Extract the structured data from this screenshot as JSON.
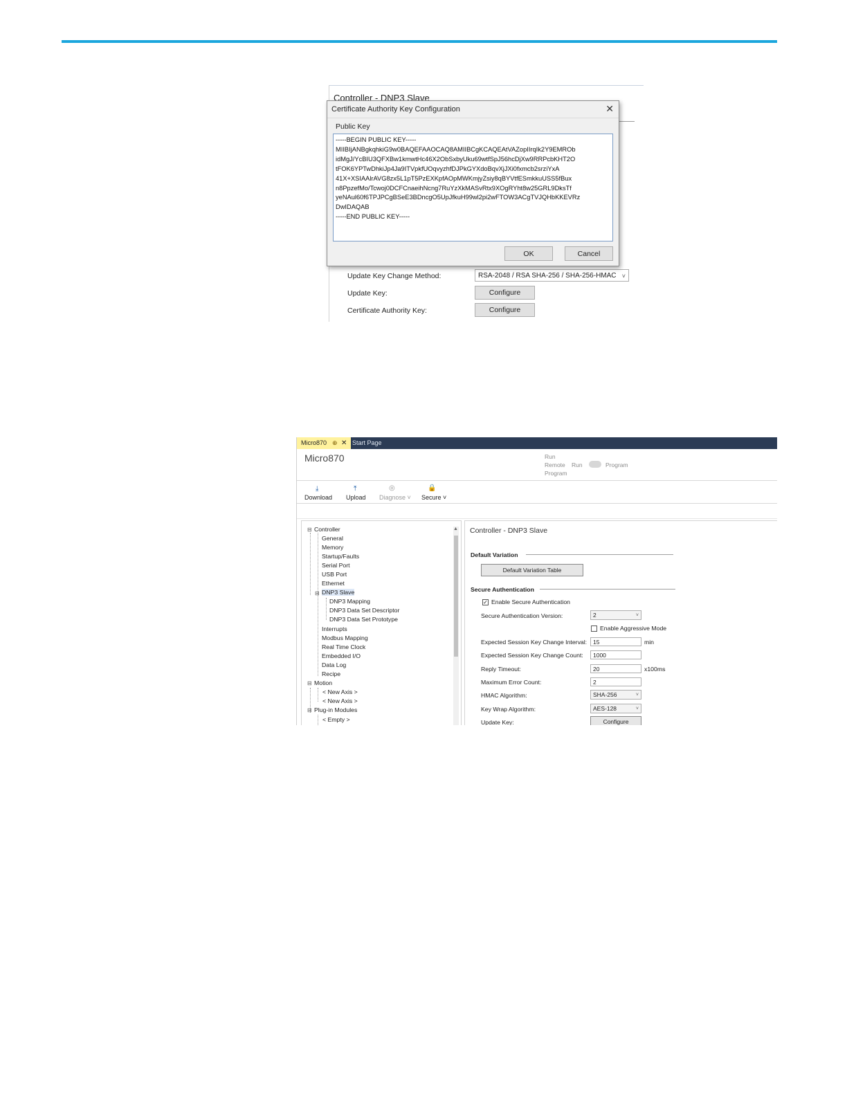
{
  "screenshot1": {
    "background_title": "Controller - DNP3 Slave",
    "update_key_change_method_label": "Update Key Change Method:",
    "update_key_change_method_value": "RSA-2048 / RSA SHA-256 / SHA-256-HMAC",
    "update_key_label": "Update Key:",
    "certificate_authority_key_label": "Certificate Authority Key:",
    "configure_label": "Configure",
    "dialog": {
      "title": "Certificate Authority Key Configuration",
      "public_key_label": "Public Key",
      "key_text": "-----BEGIN PUBLIC KEY-----\nMIIBIjANBgkqhkiG9w0BAQEFAAOCAQ8AMIIBCgKCAQEAtVAZopIIrqIk2Y9EMROb\nidMgJ/YcBIU3QFXBw1kmwtHc46X2ObSxbyUku69wtfSpJ56hcDjXw9RRPcbKHT2O\ntFOK6YPTwDhkiJp4Ja9ITVpkfUOqvyzhfDJPkGYXdoBqvXjJXi0fxmcb2srziYxA\n41X+XSIAAlrAVG8zx5L1pT5PzEXKpfAOpMWKmjyZsiy8qBYVtfESmkkuUSS5fBux\nn8PpzefMo/Tcwoj0DCFCnaeihNcng7RuYzXkMASvRtx9XOgRYht8w25GRL9DksTf\nyeNAul60f6TPJPCgBSeE3BDncgO5UpJfkuH99wl2pi2wFTOW3ACgTVJQHbKKEVRz\nDwIDAQAB\n-----END PUBLIC KEY-----",
      "ok_label": "OK",
      "cancel_label": "Cancel",
      "close_glyph": "✕"
    }
  },
  "screenshot2": {
    "tabs": [
      {
        "label": "Micro870",
        "pin": "⊕",
        "close": "✕"
      },
      {
        "label": "Start Page"
      }
    ],
    "app_title": "Micro870",
    "mode": {
      "run": "Run",
      "remote": "Remote",
      "run2": "Run",
      "program": "Program",
      "program2": "Program"
    },
    "toolbar": [
      {
        "label": "Download",
        "icon": "download-icon"
      },
      {
        "label": "Upload",
        "icon": "upload-icon"
      },
      {
        "label": "Diagnose ˅",
        "icon": "diagnose-icon"
      },
      {
        "label": "Secure ˅",
        "icon": "lock-icon"
      }
    ],
    "tree": {
      "controller": "Controller",
      "general": "General",
      "memory": "Memory",
      "startup_faults": "Startup/Faults",
      "serial_port": "Serial Port",
      "usb_port": "USB Port",
      "ethernet": "Ethernet",
      "dnp3_slave": "DNP3 Slave",
      "dnp3_mapping": "DNP3 Mapping",
      "dnp3_data_set_descriptor": "DNP3 Data Set Descriptor",
      "dnp3_data_set_prototype": "DNP3 Data Set Prototype",
      "interrupts": "Interrupts",
      "modbus_mapping": "Modbus Mapping",
      "real_time_clock": "Real Time Clock",
      "embedded_io": "Embedded I/O",
      "data_log": "Data Log",
      "recipe": "Recipe",
      "motion": "Motion",
      "new_axis_1": "< New Axis >",
      "new_axis_2": "< New Axis >",
      "plugin_modules": "Plug-in Modules",
      "empty": "< Empty >"
    },
    "panel": {
      "title": "Controller - DNP3 Slave",
      "default_variation": "Default Variation",
      "default_variation_table": "Default Variation Table",
      "secure_authentication": "Secure Authentication",
      "enable_secure_authentication": "Enable Secure Authentication",
      "enable_secure_authentication_checked": true,
      "secure_auth_version_label": "Secure Authentication Version:",
      "secure_auth_version_value": "2",
      "enable_aggressive_mode": "Enable Aggressive Mode",
      "enable_aggressive_mode_checked": false,
      "session_key_interval_label": "Expected Session Key Change Interval:",
      "session_key_interval_value": "15",
      "session_key_interval_unit": "min",
      "session_key_count_label": "Expected Session Key Change Count:",
      "session_key_count_value": "1000",
      "reply_timeout_label": "Reply Timeout:",
      "reply_timeout_value": "20",
      "reply_timeout_unit": "x100ms",
      "max_error_count_label": "Maximum Error Count:",
      "max_error_count_value": "2",
      "hmac_label": "HMAC Algorithm:",
      "hmac_value": "SHA-256",
      "key_wrap_label": "Key Wrap Algorithm:",
      "key_wrap_value": "AES-128",
      "update_key_label": "Update Key:",
      "configure_label": "Configure"
    },
    "check_glyph": "✓",
    "chevron_glyph": "˅"
  }
}
